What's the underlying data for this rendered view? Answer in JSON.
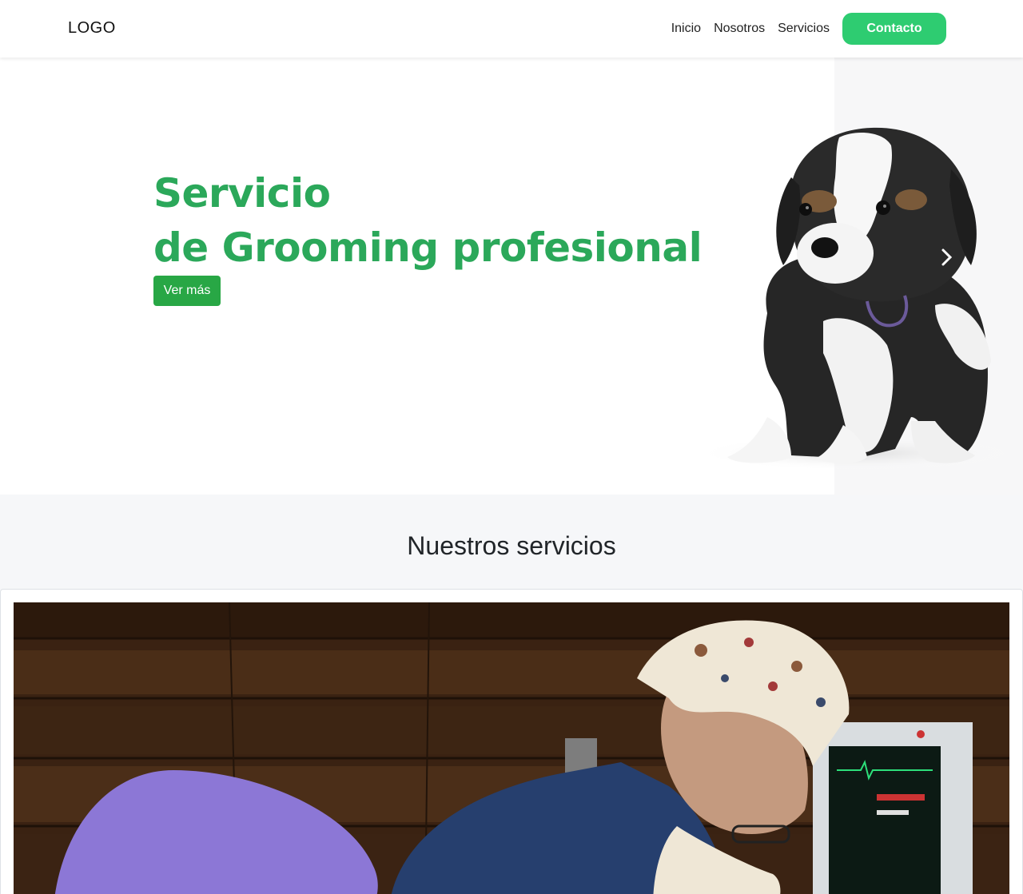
{
  "navbar": {
    "logo": "LOGO",
    "links": [
      "Inicio",
      "Nosotros",
      "Servicios"
    ],
    "cta": "Contacto"
  },
  "hero": {
    "title_line1": "Servicio",
    "title_line2": "de Grooming profesional",
    "button": "Ver más",
    "next_icon": "chevron-right-icon"
  },
  "services": {
    "title": "Nuestros servicios"
  },
  "colors": {
    "accent_green": "#2ecc71",
    "title_green": "#2ba85a",
    "button_green": "#28a745"
  }
}
